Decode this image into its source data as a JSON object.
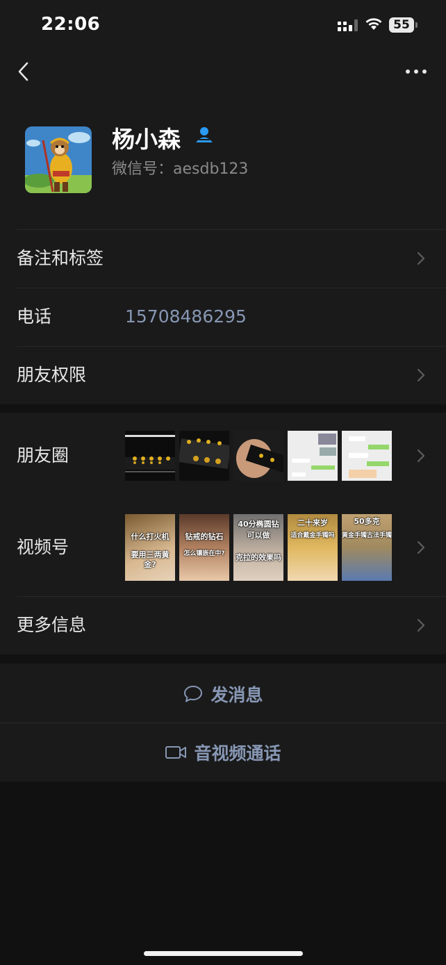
{
  "status_bar": {
    "time": "22:06",
    "battery": "55"
  },
  "profile": {
    "name": "杨小森",
    "wechat_id": "微信号：aesdb123",
    "avatar_icon": "monkey-king-avatar",
    "verified_icon": "person-icon"
  },
  "rows": {
    "remark_label": "备注和标签",
    "phone_label": "电话",
    "phone_value": "15708486295",
    "permissions_label": "朋友权限",
    "moments_label": "朋友圈",
    "channels_label": "视频号",
    "more_info_label": "更多信息"
  },
  "channels_thumbs": [
    {
      "top": "什么打火机",
      "bottom": "要用三两黄金?"
    },
    {
      "top": "钻戒的钻石",
      "bottom": "怎么镶嵌在中?"
    },
    {
      "top": "40分椭圆钻",
      "bottom": "可以做",
      "extra": "克拉的效果吗"
    },
    {
      "top": "二十来岁",
      "bottom": "适合戴金手镯吗"
    },
    {
      "top": "50多克",
      "bottom": "黄金手镯古法手镯"
    }
  ],
  "actions": {
    "message_label": "发消息",
    "call_label": "音视频通话"
  },
  "colors": {
    "background": "#111111",
    "panel": "#1a1a1a",
    "link": "#8797b4",
    "verified": "#2b9af3"
  }
}
